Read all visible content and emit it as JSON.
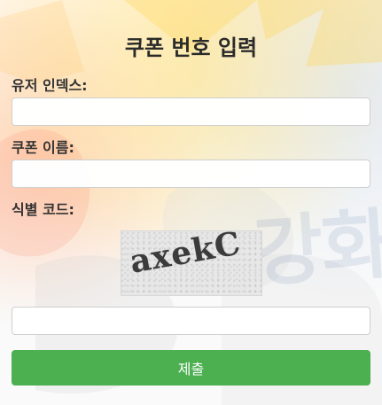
{
  "form": {
    "title": "쿠폰 번호 입력",
    "fields": {
      "user_index": {
        "label": "유저 인덱스:",
        "value": "",
        "placeholder": ""
      },
      "coupon_name": {
        "label": "쿠폰 이름:",
        "value": "",
        "placeholder": ""
      },
      "verification_code": {
        "label": "식별 코드:",
        "captcha_text": "axekC",
        "value": "",
        "placeholder": ""
      }
    },
    "submit_label": "제출"
  },
  "background": {
    "watermark_text": "강화"
  },
  "colors": {
    "primary": "#4caf50"
  }
}
